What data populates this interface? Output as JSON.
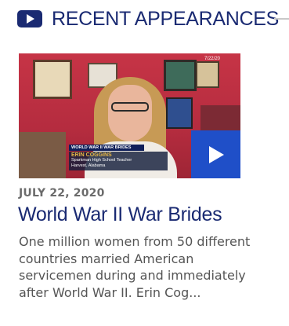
{
  "section": {
    "title": "RECENT APPEARANCES",
    "icon": "play-icon"
  },
  "video": {
    "timestamp": "7/22/20",
    "lower_third": {
      "topic": "WORLD WAR II WAR BRIDES",
      "name": "ERIN COGGINS",
      "role": "Sparkman High School Teacher",
      "place": "Harvest, Alabama"
    },
    "play_icon": "play-icon"
  },
  "post": {
    "date": "JULY 22, 2020",
    "title": "World War II War Brides",
    "excerpt": "One million women from 50 different countries married American servicemen during and immediately after World War II. Erin Cog..."
  },
  "colors": {
    "brand_navy": "#1a2a72",
    "play_blue": "#1f4fc8",
    "date_gray": "#6b6b6b",
    "text_gray": "#555555"
  }
}
